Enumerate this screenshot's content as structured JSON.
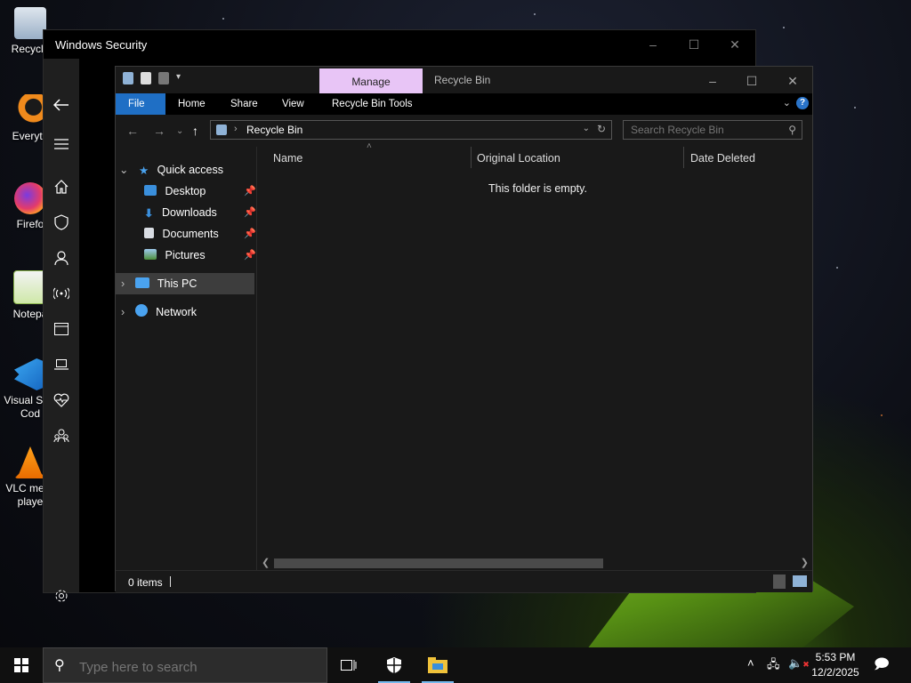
{
  "desktop": {
    "icons": [
      {
        "label": "Recycle"
      },
      {
        "label": "Everyth"
      },
      {
        "label": "Firefo"
      },
      {
        "label": "Notepa"
      },
      {
        "label": "Visual St… Cod"
      },
      {
        "label": "VLC me… playe"
      }
    ]
  },
  "security_window": {
    "title": "Windows Security",
    "minimize": "–",
    "maximize": "☐",
    "close": "✕"
  },
  "explorer": {
    "contextual_tab": "Manage",
    "title": "Recycle Bin",
    "minimize": "–",
    "maximize": "☐",
    "close": "✕",
    "ribbon_tabs": {
      "file": "File",
      "home": "Home",
      "share": "Share",
      "view": "View",
      "tools": "Recycle Bin Tools"
    },
    "help": "?",
    "address": {
      "path": "Recycle Bin"
    },
    "search": {
      "placeholder": "Search Recycle Bin"
    },
    "nav": {
      "quick_access": "Quick access",
      "desktop": "Desktop",
      "downloads": "Downloads",
      "documents": "Documents",
      "pictures": "Pictures",
      "this_pc": "This PC",
      "network": "Network"
    },
    "columns": {
      "name": "Name",
      "original_location": "Original Location",
      "date_deleted": "Date Deleted"
    },
    "empty_message": "This folder is empty.",
    "status": {
      "items": "0 items"
    }
  },
  "taskbar": {
    "search_placeholder": "Type here to search",
    "time": "5:53 PM",
    "date": "12/2/2025"
  },
  "colors": {
    "accent": "#1f6fc5",
    "manage_tab": "#e8c5f6",
    "taskbar": "#101010"
  }
}
